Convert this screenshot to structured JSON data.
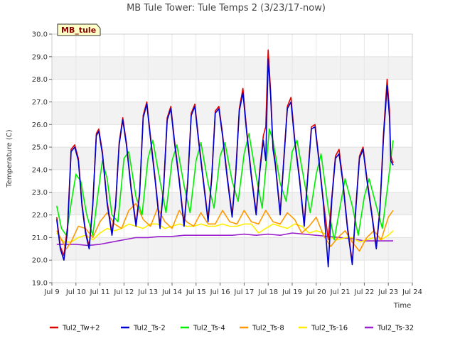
{
  "chart_data": {
    "type": "line",
    "title": "MB Tule Tower: Tule Temps 2 (3/23/17-now)",
    "xlabel": "Time",
    "ylabel": "Temperature (C)",
    "ylim": [
      19.0,
      30.0
    ],
    "xlim": [
      9.0,
      24.0
    ],
    "y_ticks": [
      "19.0",
      "20.0",
      "21.0",
      "22.0",
      "23.0",
      "24.0",
      "25.0",
      "26.0",
      "27.0",
      "28.0",
      "29.0",
      "30.0"
    ],
    "x_ticks": [
      {
        "value": 9,
        "label": "Jul 9"
      },
      {
        "value": 10,
        "label": "Jul 10"
      },
      {
        "value": 11,
        "label": "Jul 11"
      },
      {
        "value": 12,
        "label": "Jul 12"
      },
      {
        "value": 13,
        "label": "Jul 13"
      },
      {
        "value": 14,
        "label": "Jul 14"
      },
      {
        "value": 15,
        "label": "Jul 15"
      },
      {
        "value": 16,
        "label": "Jul 16"
      },
      {
        "value": 17,
        "label": "Jul 17"
      },
      {
        "value": 18,
        "label": "Jul 18"
      },
      {
        "value": 19,
        "label": "Jul 19"
      },
      {
        "value": 20,
        "label": "Jul 20"
      },
      {
        "value": 21,
        "label": "Jul 21"
      },
      {
        "value": 22,
        "label": "Jul 22"
      },
      {
        "value": 23,
        "label": "Jul 23"
      },
      {
        "value": 24,
        "label": "Jul 24"
      }
    ],
    "grid": true,
    "legend_position": "bottom",
    "badge": "MB_tule",
    "series": [
      {
        "name": "Tul2_Tw+2",
        "color": "#dd0000",
        "x": [
          9.2,
          9.35,
          9.5,
          9.65,
          9.8,
          9.95,
          10.1,
          10.25,
          10.4,
          10.55,
          10.7,
          10.85,
          10.95,
          11.1,
          11.3,
          11.5,
          11.65,
          11.8,
          11.95,
          12.1,
          12.3,
          12.5,
          12.65,
          12.8,
          12.95,
          13.1,
          13.3,
          13.5,
          13.65,
          13.8,
          13.95,
          14.1,
          14.3,
          14.5,
          14.65,
          14.8,
          14.95,
          15.1,
          15.3,
          15.5,
          15.65,
          15.8,
          15.95,
          16.1,
          16.3,
          16.5,
          16.65,
          16.8,
          16.95,
          17.1,
          17.3,
          17.5,
          17.65,
          17.8,
          17.9,
          18.0,
          18.1,
          18.2,
          18.3,
          18.5,
          18.65,
          18.8,
          18.95,
          19.1,
          19.3,
          19.5,
          19.65,
          19.8,
          19.95,
          20.1,
          20.3,
          20.5,
          20.65,
          20.8,
          20.95,
          21.1,
          21.3,
          21.5,
          21.65,
          21.8,
          21.95,
          22.1,
          22.3,
          22.5,
          22.65,
          22.8,
          22.95,
          23.05,
          23.1,
          23.2
        ],
        "y": [
          21.9,
          20.6,
          20.2,
          21.5,
          24.9,
          25.1,
          24.5,
          22.5,
          21.3,
          20.6,
          22.5,
          25.6,
          25.8,
          24.8,
          22.6,
          21.2,
          22.5,
          25.2,
          26.3,
          25.2,
          23.2,
          21.6,
          23.0,
          26.4,
          27.0,
          25.5,
          23.6,
          21.5,
          23.3,
          26.3,
          26.8,
          25.3,
          23.6,
          21.6,
          23.5,
          26.5,
          26.9,
          25.4,
          23.6,
          21.8,
          23.7,
          26.6,
          26.8,
          25.6,
          23.7,
          22.0,
          23.9,
          26.7,
          27.6,
          25.8,
          23.8,
          22.1,
          24.0,
          25.5,
          25.9,
          29.3,
          27.5,
          25.0,
          24.3,
          22.1,
          24.5,
          26.8,
          27.2,
          25.4,
          23.7,
          21.6,
          23.8,
          25.9,
          26.0,
          24.6,
          22.6,
          20.9,
          22.8,
          24.6,
          24.9,
          23.6,
          21.5,
          19.9,
          22.4,
          24.6,
          25.0,
          23.7,
          22.2,
          20.6,
          22.3,
          25.6,
          28.0,
          26.6,
          24.6,
          24.3
        ]
      },
      {
        "name": "Tul2_Ts-2",
        "color": "#0000cc",
        "x": [
          9.2,
          9.35,
          9.5,
          9.65,
          9.8,
          9.95,
          10.1,
          10.25,
          10.4,
          10.55,
          10.7,
          10.85,
          10.95,
          11.1,
          11.3,
          11.5,
          11.65,
          11.8,
          11.95,
          12.1,
          12.3,
          12.5,
          12.65,
          12.8,
          12.95,
          13.1,
          13.3,
          13.5,
          13.65,
          13.8,
          13.95,
          14.1,
          14.3,
          14.5,
          14.65,
          14.8,
          14.95,
          15.1,
          15.3,
          15.5,
          15.65,
          15.8,
          15.95,
          16.1,
          16.3,
          16.5,
          16.65,
          16.8,
          16.95,
          17.1,
          17.3,
          17.5,
          17.65,
          17.8,
          17.9,
          18.0,
          18.1,
          18.2,
          18.3,
          18.5,
          18.65,
          18.8,
          18.95,
          19.1,
          19.3,
          19.5,
          19.65,
          19.8,
          19.95,
          20.1,
          20.3,
          20.5,
          20.65,
          20.8,
          20.95,
          21.1,
          21.3,
          21.5,
          21.65,
          21.8,
          21.95,
          22.1,
          22.3,
          22.5,
          22.65,
          22.8,
          22.95,
          23.05,
          23.1,
          23.2
        ],
        "y": [
          21.8,
          20.5,
          20.0,
          21.3,
          24.8,
          25.0,
          24.4,
          22.4,
          21.2,
          20.5,
          22.4,
          25.5,
          25.7,
          24.7,
          22.5,
          21.1,
          22.4,
          25.1,
          26.2,
          25.1,
          23.1,
          21.5,
          22.9,
          26.3,
          26.9,
          25.4,
          23.5,
          21.4,
          23.2,
          26.2,
          26.7,
          25.2,
          23.5,
          21.5,
          23.4,
          26.4,
          26.8,
          25.3,
          23.5,
          21.7,
          23.6,
          26.5,
          26.7,
          25.5,
          23.6,
          21.9,
          23.8,
          26.6,
          27.4,
          25.7,
          23.7,
          22.0,
          23.9,
          25.3,
          24.4,
          28.9,
          27.3,
          24.9,
          24.2,
          22.0,
          24.4,
          26.7,
          27.0,
          25.3,
          23.6,
          21.5,
          23.7,
          25.8,
          25.9,
          24.5,
          22.5,
          19.7,
          22.7,
          24.5,
          24.7,
          23.5,
          21.4,
          19.8,
          22.3,
          24.5,
          24.9,
          23.6,
          22.1,
          20.5,
          22.2,
          25.4,
          27.7,
          26.3,
          24.4,
          24.2
        ]
      },
      {
        "name": "Tul2_Ts-4",
        "color": "#00ee00",
        "x": [
          9.2,
          9.4,
          9.6,
          9.8,
          10.0,
          10.2,
          10.45,
          10.7,
          10.95,
          11.1,
          11.3,
          11.5,
          11.75,
          12.0,
          12.2,
          12.5,
          12.75,
          13.0,
          13.2,
          13.5,
          13.75,
          14.0,
          14.2,
          14.5,
          14.75,
          15.0,
          15.2,
          15.5,
          15.75,
          16.0,
          16.2,
          16.5,
          16.75,
          17.0,
          17.2,
          17.5,
          17.75,
          18.05,
          18.2,
          18.5,
          18.75,
          19.0,
          19.2,
          19.5,
          19.75,
          20.0,
          20.2,
          20.5,
          20.75,
          21.0,
          21.2,
          21.5,
          21.75,
          22.0,
          22.2,
          22.5,
          22.75,
          23.0,
          23.2
        ],
        "y": [
          22.4,
          21.4,
          21.1,
          22.5,
          23.8,
          23.5,
          22.0,
          21.1,
          23.2,
          24.4,
          23.6,
          22.0,
          21.7,
          24.5,
          24.8,
          22.8,
          22.0,
          24.5,
          25.3,
          23.5,
          22.1,
          24.4,
          25.1,
          23.3,
          22.1,
          24.4,
          25.2,
          23.4,
          22.3,
          24.6,
          25.2,
          23.5,
          22.6,
          24.7,
          25.6,
          23.7,
          22.3,
          25.8,
          25.3,
          23.4,
          22.6,
          24.8,
          25.3,
          23.5,
          22.1,
          23.8,
          24.7,
          22.3,
          20.9,
          22.4,
          23.6,
          22.4,
          21.1,
          22.8,
          23.6,
          22.4,
          21.4,
          23.5,
          25.3
        ]
      },
      {
        "name": "Tul2_Ts-8",
        "color": "#ff9900",
        "x": [
          9.2,
          9.4,
          9.6,
          9.8,
          10.1,
          10.4,
          10.7,
          11.0,
          11.3,
          11.6,
          11.9,
          12.2,
          12.5,
          12.8,
          13.1,
          13.4,
          13.7,
          14.0,
          14.3,
          14.6,
          14.9,
          15.2,
          15.5,
          15.8,
          16.1,
          16.4,
          16.7,
          17.0,
          17.3,
          17.6,
          17.9,
          18.2,
          18.5,
          18.8,
          19.1,
          19.4,
          19.7,
          20.0,
          20.3,
          20.6,
          20.9,
          21.2,
          21.5,
          21.8,
          22.1,
          22.4,
          22.7,
          23.0,
          23.2
        ],
        "y": [
          21.3,
          20.9,
          20.5,
          20.8,
          21.5,
          21.4,
          21.0,
          21.7,
          22.1,
          21.6,
          21.4,
          22.2,
          22.5,
          21.8,
          21.5,
          22.3,
          21.7,
          21.4,
          22.2,
          21.7,
          21.5,
          22.1,
          21.6,
          21.6,
          22.2,
          21.7,
          21.6,
          22.2,
          21.7,
          21.6,
          22.2,
          21.7,
          21.6,
          22.1,
          21.8,
          21.2,
          21.5,
          21.9,
          21.1,
          20.6,
          21.0,
          21.3,
          20.8,
          20.4,
          21.0,
          21.3,
          20.9,
          21.9,
          22.2
        ]
      },
      {
        "name": "Tul2_Ts-16",
        "color": "#ffee00",
        "x": [
          9.2,
          9.5,
          9.8,
          10.1,
          10.4,
          10.7,
          11.0,
          11.3,
          11.6,
          11.9,
          12.2,
          12.5,
          12.8,
          13.1,
          13.4,
          13.7,
          14.0,
          14.3,
          14.6,
          14.9,
          15.2,
          15.5,
          15.8,
          16.1,
          16.4,
          16.7,
          17.0,
          17.3,
          17.6,
          17.9,
          18.2,
          18.5,
          18.8,
          19.1,
          19.4,
          19.7,
          20.0,
          20.3,
          20.6,
          20.9,
          21.2,
          21.5,
          21.8,
          22.1,
          22.4,
          22.7,
          23.0,
          23.2
        ],
        "y": [
          21.2,
          20.8,
          20.8,
          21.0,
          21.1,
          20.9,
          21.2,
          21.4,
          21.3,
          21.4,
          21.6,
          21.5,
          21.4,
          21.6,
          21.6,
          21.4,
          21.5,
          21.6,
          21.5,
          21.5,
          21.6,
          21.5,
          21.5,
          21.6,
          21.5,
          21.5,
          21.6,
          21.6,
          21.2,
          21.4,
          21.6,
          21.5,
          21.4,
          21.6,
          21.5,
          21.2,
          21.3,
          21.2,
          21.0,
          20.9,
          21.0,
          21.0,
          20.8,
          20.9,
          21.0,
          20.9,
          21.1,
          21.3
        ]
      },
      {
        "name": "Tul2_Ts-32",
        "color": "#9922cc",
        "x": [
          9.2,
          9.6,
          10.0,
          10.5,
          11.0,
          11.5,
          12.0,
          12.5,
          13.0,
          13.5,
          14.0,
          14.5,
          15.0,
          15.5,
          16.0,
          16.5,
          17.0,
          17.5,
          18.0,
          18.5,
          19.0,
          19.5,
          20.0,
          20.5,
          21.0,
          21.5,
          22.0,
          22.5,
          23.0,
          23.2
        ],
        "y": [
          20.7,
          20.7,
          20.7,
          20.65,
          20.7,
          20.8,
          20.9,
          21.0,
          21.0,
          21.05,
          21.05,
          21.1,
          21.1,
          21.1,
          21.1,
          21.1,
          21.15,
          21.1,
          21.15,
          21.1,
          21.2,
          21.15,
          21.1,
          21.05,
          21.0,
          20.95,
          20.85,
          20.85,
          20.85,
          20.85
        ]
      }
    ]
  }
}
